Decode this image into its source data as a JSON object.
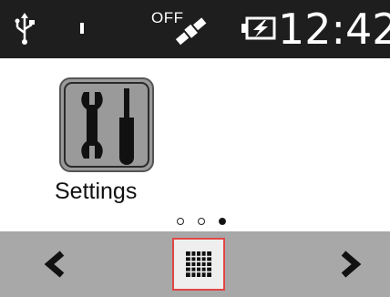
{
  "status_bar": {
    "usb_icon": "usb-icon",
    "signal_icon": "signal-icon",
    "gps_status": "OFF",
    "gps_icon": "satellite-icon",
    "battery_icon": "battery-charging-icon",
    "time": "12:42"
  },
  "home": {
    "apps": [
      {
        "label": "Settings",
        "icon": "tools-icon"
      }
    ],
    "pager": {
      "pages": 3,
      "active_index": 2
    }
  },
  "nav": {
    "prev_icon": "chevron-left-icon",
    "drawer_icon": "app-grid-icon",
    "next_icon": "chevron-right-icon",
    "highlight_color": "#e04646"
  },
  "colors": {
    "status_bar_bg": "#1e1e1e",
    "nav_bar_bg": "#a8a8a8",
    "tile_bg": "#9a9a9a"
  }
}
